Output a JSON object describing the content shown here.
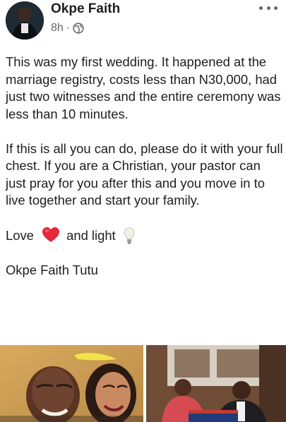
{
  "post": {
    "author": "Okpe Faith",
    "time": "8h",
    "separator": "·",
    "visibility_icon": "globe-icon",
    "more_icon": "ellipsis-icon",
    "paragraphs": {
      "p1": "This was my first wedding. It happened at the marriage registry, costs less than N30,000, had just two witnesses and the entire ceremony was less than 10 minutes.",
      "p2": "If this is all you can do, please do it with your full chest. If you are a Christian,  your pastor can just pray for you after this and you move in to live together and start your family.",
      "p3_love": "Love",
      "p3_and_light": "and light",
      "signature": "Okpe Faith Tutu"
    },
    "emojis": [
      "red-heart-icon",
      "light-bulb-icon"
    ]
  },
  "colors": {
    "text": "#1c1e21",
    "muted": "#65676b",
    "heart": "#e8273b"
  }
}
